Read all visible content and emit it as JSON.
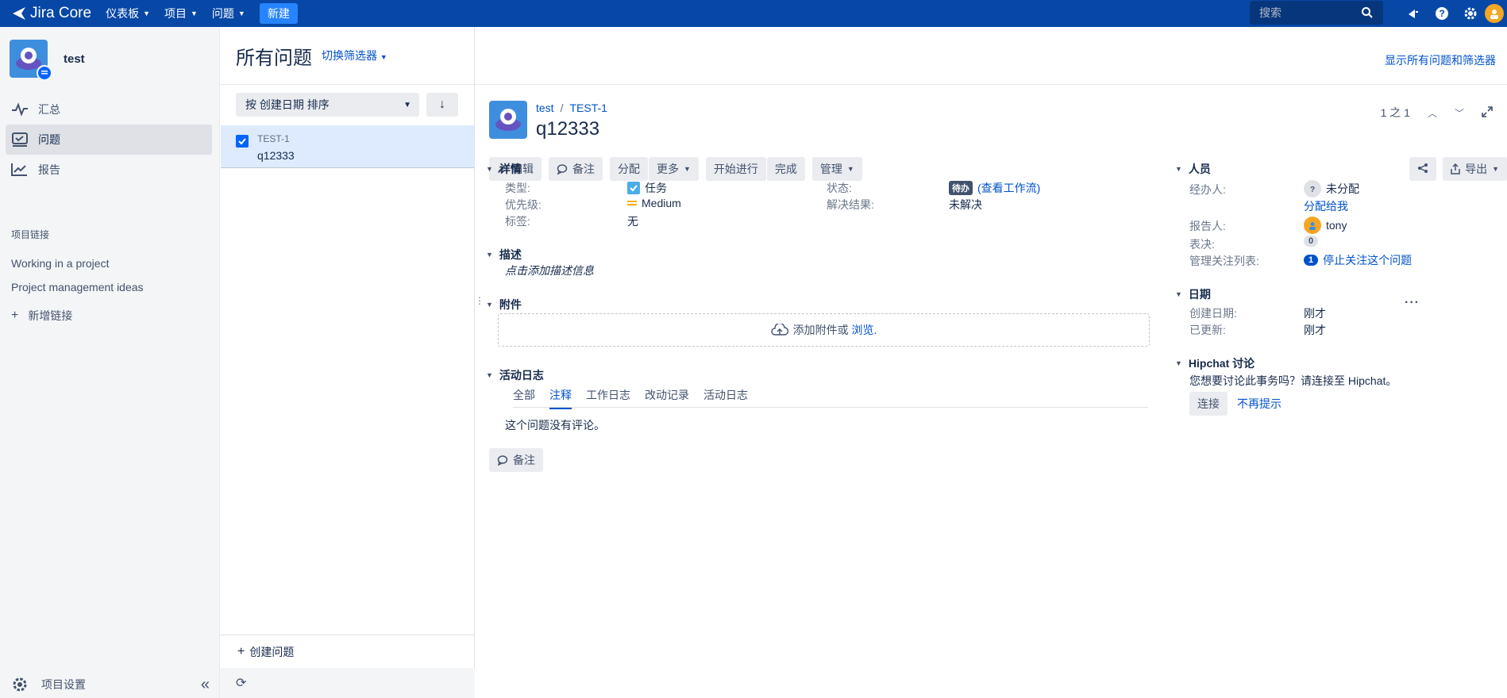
{
  "topbar": {
    "logo": "Jira Core",
    "nav": [
      {
        "label": "仪表板"
      },
      {
        "label": "项目"
      },
      {
        "label": "问题"
      }
    ],
    "create": "新建",
    "search_placeholder": "搜索"
  },
  "sidebar": {
    "project_name": "test",
    "items": [
      {
        "label": "汇总"
      },
      {
        "label": "问题"
      },
      {
        "label": "报告"
      }
    ],
    "links_title": "项目链接",
    "links": [
      "Working in a project",
      "Project management ideas"
    ],
    "add_link": "新增链接",
    "settings": "项目设置"
  },
  "header": {
    "title": "所有问题",
    "switch_filter": "切换筛选器",
    "show_all": "显示所有问题和筛选器"
  },
  "list": {
    "sort_label": "按 创建日期 排序",
    "issues": [
      {
        "key": "TEST-1",
        "summary": "q12333"
      }
    ],
    "create_issue": "创建问题"
  },
  "issue": {
    "breadcrumb_project": "test",
    "breadcrumb_key": "TEST-1",
    "title": "q12333",
    "pager": "1 之 1",
    "toolbar": {
      "edit": "编辑",
      "comment": "备注",
      "assign": "分配",
      "more": "更多",
      "start": "开始进行",
      "done": "完成",
      "admin": "管理",
      "export": "导出"
    },
    "details": {
      "title": "详情",
      "type_label": "类型:",
      "type_value": "任务",
      "priority_label": "优先级:",
      "priority_value": "Medium",
      "labels_label": "标签:",
      "labels_value": "无",
      "status_label": "状态:",
      "status_value": "待办",
      "view_workflow": "(查看工作流)",
      "resolution_label": "解决结果:",
      "resolution_value": "未解决"
    },
    "description": {
      "title": "描述",
      "placeholder": "点击添加描述信息"
    },
    "attachments": {
      "title": "附件",
      "drop_text": "添加附件或",
      "browse": "浏览."
    },
    "activity": {
      "title": "活动日志",
      "tabs": [
        "全部",
        "注释",
        "工作日志",
        "改动记录",
        "活动日志"
      ],
      "active_tab": "注释",
      "empty": "这个问题没有评论。"
    },
    "comment_button": "备注",
    "people": {
      "title": "人员",
      "assignee_label": "经办人:",
      "assignee_value": "未分配",
      "assign_to_me": "分配给我",
      "reporter_label": "报告人:",
      "reporter_value": "tony",
      "votes_label": "表决:",
      "votes_value": "0",
      "watchers_label": "管理关注列表:",
      "watchers_value": "1",
      "stop_watching": "停止关注这个问题"
    },
    "dates": {
      "title": "日期",
      "created_label": "创建日期:",
      "created_value": "刚才",
      "updated_label": "已更新:",
      "updated_value": "刚才"
    },
    "hipchat": {
      "title": "Hipchat 讨论",
      "text": "您想要讨论此事务吗？请连接至 Hipchat。",
      "connect": "连接",
      "dismiss": "不再提示"
    }
  },
  "colors": {
    "topbar": "#0747a6",
    "link": "#0052cc",
    "selected_row": "#deebff"
  }
}
